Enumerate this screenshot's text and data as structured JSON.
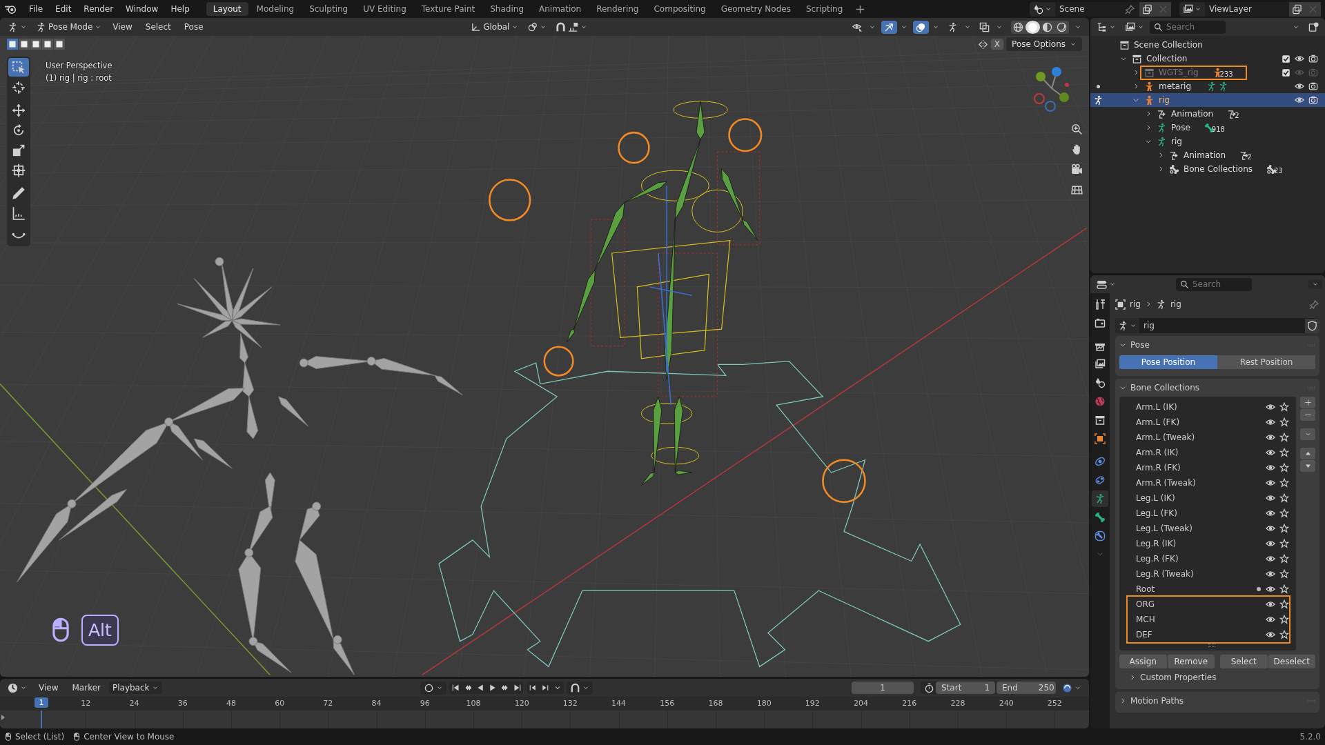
{
  "menu_bar": {
    "menus": [
      "File",
      "Edit",
      "Render",
      "Window",
      "Help"
    ],
    "workspaces": [
      {
        "label": "Layout",
        "selected": true
      },
      {
        "label": "Modeling",
        "selected": false
      },
      {
        "label": "Sculpting",
        "selected": false
      },
      {
        "label": "UV Editing",
        "selected": false
      },
      {
        "label": "Texture Paint",
        "selected": false
      },
      {
        "label": "Shading",
        "selected": false
      },
      {
        "label": "Animation",
        "selected": false
      },
      {
        "label": "Rendering",
        "selected": false
      },
      {
        "label": "Compositing",
        "selected": false
      },
      {
        "label": "Geometry Nodes",
        "selected": false
      },
      {
        "label": "Scripting",
        "selected": false
      }
    ],
    "scene": "Scene",
    "view_layer": "ViewLayer"
  },
  "viewport": {
    "mode": "Pose Mode",
    "menus": [
      "View",
      "Select",
      "Pose"
    ],
    "orientation": "Global",
    "x_mirror": "X",
    "pose_options": "Pose Options",
    "select_modes": [
      {
        "selected": true
      },
      {
        "selected": false
      },
      {
        "selected": false
      },
      {
        "selected": false
      },
      {
        "selected": false
      }
    ],
    "header_toggles": [
      {
        "kind": "visibility",
        "on": false
      },
      {
        "kind": "gizmo",
        "on": true
      },
      {
        "kind": "overlay",
        "on": true
      },
      {
        "kind": "pose",
        "on": false
      },
      {
        "kind": "xray",
        "on": false
      }
    ],
    "shading": [
      {
        "kind": "wireframe",
        "selected": false
      },
      {
        "kind": "solid",
        "selected": true
      },
      {
        "kind": "material",
        "selected": false
      },
      {
        "kind": "rendered",
        "selected": false
      }
    ],
    "perspective": "User Perspective",
    "object_info": "(1) rig | rig : root",
    "tools": [
      {
        "kind": "select_box",
        "selected": true
      },
      {
        "kind": "cursor",
        "selected": false
      },
      {
        "kind": "move",
        "selected": false
      },
      {
        "kind": "rotate",
        "selected": false
      },
      {
        "kind": "scale",
        "selected": false
      },
      {
        "kind": "transform",
        "selected": false
      },
      {
        "kind": "annotate",
        "selected": false
      },
      {
        "kind": "measure",
        "selected": false
      },
      {
        "kind": "relax",
        "selected": false
      }
    ],
    "key_hint": "Alt"
  },
  "outliner": {
    "search_placeholder": "Search",
    "tree": [
      {
        "label": "Scene Collection",
        "kind": "scene_collection",
        "selected": false,
        "children": [
          {
            "label": "Collection",
            "kind": "collection",
            "selected": false,
            "expanded": true,
            "checked": true,
            "visible": true,
            "children": [
              {
                "label": "WGTS_rig",
                "kind": "collection",
                "selected": false,
                "expanded": false,
                "dimmed": true,
                "annotated": true,
                "badge": "233",
                "checked": true,
                "visible": false
              },
              {
                "label": "metarig",
                "kind": "armature",
                "selected": false,
                "expanded": false,
                "in_pose_mode": false,
                "visible": true
              },
              {
                "label": "rig",
                "kind": "armature",
                "selected": true,
                "expanded": true,
                "in_pose_mode": true,
                "visible": true,
                "children": [
                  {
                    "label": "Animation",
                    "kind": "action",
                    "selected": false,
                    "expanded": false,
                    "badge": "2"
                  },
                  {
                    "label": "Pose",
                    "kind": "pose",
                    "selected": false,
                    "expanded": false,
                    "badge": "918"
                  },
                  {
                    "label": "rig",
                    "kind": "armature_data",
                    "selected": false,
                    "expanded": true,
                    "children": [
                      {
                        "label": "Animation",
                        "kind": "action",
                        "selected": false,
                        "expanded": false,
                        "badge": "2"
                      },
                      {
                        "label": "Bone Collections",
                        "kind": "bone_collections",
                        "selected": false,
                        "expanded": false,
                        "badge": "23"
                      }
                    ]
                  }
                ]
              }
            ]
          }
        ]
      }
    ]
  },
  "properties": {
    "search_placeholder": "Search",
    "tabs": [
      {
        "kind": "tool",
        "selected": false
      },
      {
        "kind": "render",
        "selected": false
      },
      {
        "kind": "output",
        "selected": false
      },
      {
        "kind": "view_layer",
        "selected": false
      },
      {
        "kind": "scene",
        "selected": false
      },
      {
        "kind": "world",
        "selected": false
      },
      {
        "kind": "collection",
        "selected": false
      },
      {
        "kind": "object",
        "selected": false
      },
      {
        "kind": "physics",
        "selected": false
      },
      {
        "kind": "constraints",
        "selected": false
      },
      {
        "kind": "data",
        "selected": true
      },
      {
        "kind": "bone",
        "selected": false
      },
      {
        "kind": "bone_constraint",
        "selected": false
      }
    ],
    "breadcrumb": [
      "rig",
      "rig"
    ],
    "datablock": "rig",
    "pose_panel": {
      "title": "Pose",
      "expanded": true,
      "positions": [
        {
          "label": "Pose Position",
          "selected": true
        },
        {
          "label": "Rest Position",
          "selected": false
        }
      ]
    },
    "bone_collections_panel": {
      "title": "Bone Collections",
      "expanded": true,
      "items": [
        {
          "name": "Arm.L (IK)",
          "visible": true,
          "dot": false,
          "annotated": false
        },
        {
          "name": "Arm.L (FK)",
          "visible": true,
          "dot": false,
          "annotated": false
        },
        {
          "name": "Arm.L (Tweak)",
          "visible": true,
          "dot": false,
          "annotated": false
        },
        {
          "name": "Arm.R (IK)",
          "visible": true,
          "dot": false,
          "annotated": false
        },
        {
          "name": "Arm.R (FK)",
          "visible": true,
          "dot": false,
          "annotated": false
        },
        {
          "name": "Arm.R (Tweak)",
          "visible": true,
          "dot": false,
          "annotated": false
        },
        {
          "name": "Leg.L (IK)",
          "visible": true,
          "dot": false,
          "annotated": false
        },
        {
          "name": "Leg.L (FK)",
          "visible": true,
          "dot": false,
          "annotated": false
        },
        {
          "name": "Leg.L (Tweak)",
          "visible": true,
          "dot": false,
          "annotated": false
        },
        {
          "name": "Leg.R (IK)",
          "visible": true,
          "dot": false,
          "annotated": false
        },
        {
          "name": "Leg.R (FK)",
          "visible": true,
          "dot": false,
          "annotated": false
        },
        {
          "name": "Leg.R (Tweak)",
          "visible": true,
          "dot": false,
          "annotated": false
        },
        {
          "name": "Root",
          "visible": true,
          "dot": true,
          "annotated": false
        },
        {
          "name": "ORG",
          "visible": true,
          "dot": false,
          "annotated": true
        },
        {
          "name": "MCH",
          "visible": true,
          "dot": false,
          "annotated": true
        },
        {
          "name": "DEF",
          "visible": true,
          "dot": false,
          "annotated": true
        }
      ],
      "buttons": [
        "Assign",
        "Remove",
        "Select",
        "Deselect"
      ],
      "subpanel": {
        "title": "Custom Properties",
        "expanded": false
      }
    },
    "collapsed_panels": [
      {
        "title": "Motion Paths",
        "expanded": false
      }
    ]
  },
  "timeline": {
    "menus": [
      "View",
      "Marker",
      "Playback"
    ],
    "current_frame": "1",
    "start_label": "Start",
    "start": "1",
    "end_label": "End",
    "end": "250",
    "ruler_current": "1",
    "ruler_ticks": [
      "12",
      "24",
      "36",
      "48",
      "60",
      "72",
      "84",
      "96",
      "108",
      "120",
      "132",
      "144",
      "156",
      "168",
      "180",
      "192",
      "204",
      "216",
      "228",
      "240",
      "252"
    ]
  },
  "status_bar": {
    "hints": [
      "Select (List)",
      "Center View to Mouse"
    ],
    "version": "5.2.0"
  }
}
